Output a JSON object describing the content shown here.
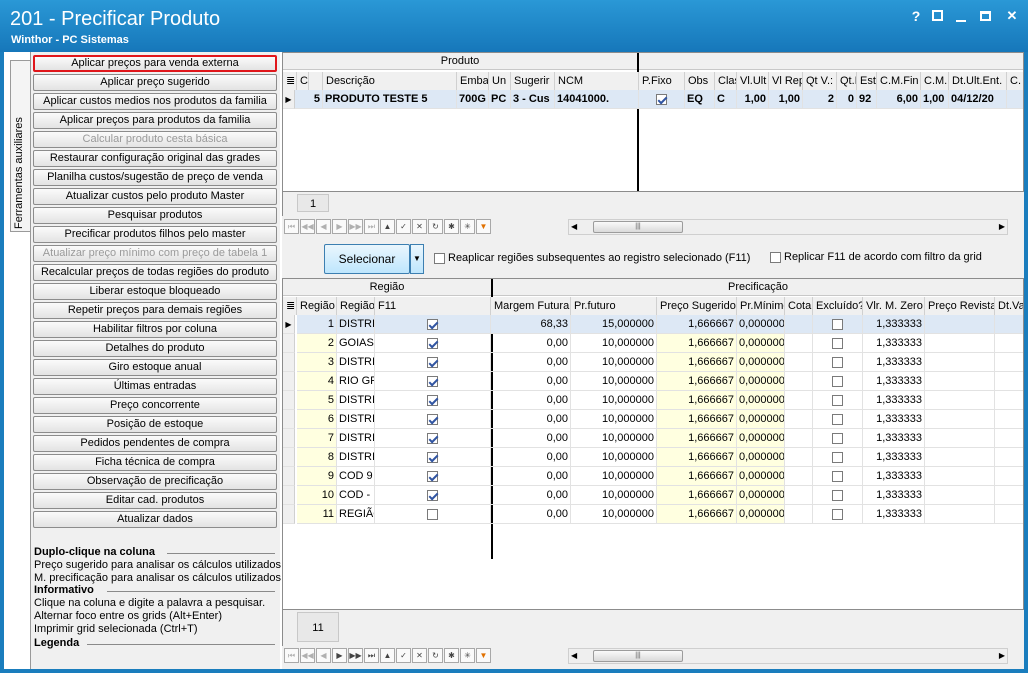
{
  "window": {
    "title": "201 - Precificar Produto",
    "subtitle": "Winthor - PC Sistemas",
    "help_glyph": "?"
  },
  "sidebar_tab": "Ferramentas auxiliares",
  "actions": [
    {
      "label": "Aplicar preços para venda externa",
      "state": "active"
    },
    {
      "label": "Aplicar preço sugerido",
      "state": "normal"
    },
    {
      "label": "Aplicar custos medios nos produtos da familia",
      "state": "normal"
    },
    {
      "label": "Aplicar preços para produtos da familia",
      "state": "normal"
    },
    {
      "label": "Calcular produto cesta básica",
      "state": "disabled"
    },
    {
      "label": "Restaurar configuração original das grades",
      "state": "normal"
    },
    {
      "label": "Planilha custos/sugestão de preço de venda",
      "state": "normal"
    },
    {
      "label": "Atualizar custos pelo produto Master",
      "state": "normal"
    },
    {
      "label": "Pesquisar produtos",
      "state": "normal"
    },
    {
      "label": "Precificar produtos filhos pelo master",
      "state": "normal"
    },
    {
      "label": "Atualizar preço mínimo com preço de tabela 1",
      "state": "disabled"
    },
    {
      "label": "Recalcular preços de todas regiões do produto",
      "state": "normal"
    },
    {
      "label": "Liberar estoque bloqueado",
      "state": "normal"
    },
    {
      "label": "Repetir preços para demais regiões",
      "state": "normal"
    },
    {
      "label": "Habilitar filtros por coluna",
      "state": "normal"
    },
    {
      "label": "Detalhes do produto",
      "state": "normal"
    },
    {
      "label": "Giro estoque anual",
      "state": "normal"
    },
    {
      "label": "Últimas entradas",
      "state": "normal"
    },
    {
      "label": "Preço concorrente",
      "state": "normal"
    },
    {
      "label": "Posição de estoque",
      "state": "normal"
    },
    {
      "label": "Pedidos pendentes de compra",
      "state": "normal"
    },
    {
      "label": "Ficha técnica de compra",
      "state": "normal"
    },
    {
      "label": "Observação de precificação",
      "state": "normal"
    },
    {
      "label": "Editar cad. produtos",
      "state": "normal"
    },
    {
      "label": "Atualizar dados",
      "state": "normal"
    }
  ],
  "help": {
    "dbl_header": "Duplo-clique na coluna",
    "dbl_line1": "Preço sugerido para analisar os cálculos utilizados.",
    "dbl_line2": "M. precificação para analisar os cálculos utilizados.",
    "info_header": "Informativo",
    "info_line1": "Clique na coluna e digite a palavra a pesquisar.",
    "info_line2": "Alternar foco entre os grids (Alt+Enter)",
    "info_line3": "Imprimir grid selecionada (Ctrl+T)",
    "legend_header": "Legenda"
  },
  "product_grid": {
    "band_title": "Produto",
    "columns": [
      "C",
      "",
      "Descrição",
      "Emba",
      "Un",
      "Sugerir",
      "NCM",
      "P.Fixo",
      "Obs",
      "Clas",
      "Vl.Ult",
      "Vl Rep",
      "Qt V.:",
      "Qt.I",
      "Est",
      "C.M.Fin",
      "C.M.",
      "Dt.Ult.Ent.",
      "C."
    ],
    "row": [
      "5",
      "PRODUTO TESTE 5",
      "700G",
      "PC",
      "3 - Cus",
      "14041000.",
      "",
      "EQ",
      "C",
      "1,00",
      "1,00",
      "2",
      "0",
      "92",
      "6,00",
      "1,00",
      "04/12/20",
      ""
    ],
    "row_pfixo_checked": true,
    "count": "1"
  },
  "toolbar": {
    "select_label": "Selecionar",
    "opt1_label": "Reaplicar regiões subsequentes ao registro selecionado (F11)",
    "opt2_label": "Replicar F11 de acordo com filtro da grid"
  },
  "region_grid": {
    "band_region": "Região",
    "band_pricing": "Precificação",
    "columns": [
      "Região",
      "Região",
      "F11",
      "Margem Futura",
      "Pr.futuro",
      "Preço Sugerido",
      "Pr.Mínimo",
      "Cota",
      "Excluído?",
      "Vlr. M. Zero",
      "Preço Revista",
      "Dt.Va"
    ],
    "rows": [
      {
        "id": "1",
        "name": "DISTRI",
        "f11": true,
        "margem": "68,33",
        "prfuturo": "15,000000",
        "sugerido": "1,666667",
        "prmin": "0,000000",
        "excluido": false,
        "zero": "1,333333"
      },
      {
        "id": "2",
        "name": "GOIAS",
        "f11": true,
        "margem": "0,00",
        "prfuturo": "10,000000",
        "sugerido": "1,666667",
        "prmin": "0,000000",
        "excluido": false,
        "zero": "1,333333"
      },
      {
        "id": "3",
        "name": "DISTRI",
        "f11": true,
        "margem": "0,00",
        "prfuturo": "10,000000",
        "sugerido": "1,666667",
        "prmin": "0,000000",
        "excluido": false,
        "zero": "1,333333"
      },
      {
        "id": "4",
        "name": "RIO GR",
        "f11": true,
        "margem": "0,00",
        "prfuturo": "10,000000",
        "sugerido": "1,666667",
        "prmin": "0,000000",
        "excluido": false,
        "zero": "1,333333"
      },
      {
        "id": "5",
        "name": "DISTRI",
        "f11": true,
        "margem": "0,00",
        "prfuturo": "10,000000",
        "sugerido": "1,666667",
        "prmin": "0,000000",
        "excluido": false,
        "zero": "1,333333"
      },
      {
        "id": "6",
        "name": "DISTRI",
        "f11": true,
        "margem": "0,00",
        "prfuturo": "10,000000",
        "sugerido": "1,666667",
        "prmin": "0,000000",
        "excluido": false,
        "zero": "1,333333"
      },
      {
        "id": "7",
        "name": "DISTRI",
        "f11": true,
        "margem": "0,00",
        "prfuturo": "10,000000",
        "sugerido": "1,666667",
        "prmin": "0,000000",
        "excluido": false,
        "zero": "1,333333"
      },
      {
        "id": "8",
        "name": "DISTRI",
        "f11": true,
        "margem": "0,00",
        "prfuturo": "10,000000",
        "sugerido": "1,666667",
        "prmin": "0,000000",
        "excluido": false,
        "zero": "1,333333"
      },
      {
        "id": "9",
        "name": "COD 9",
        "f11": true,
        "margem": "0,00",
        "prfuturo": "10,000000",
        "sugerido": "1,666667",
        "prmin": "0,000000",
        "excluido": false,
        "zero": "1,333333"
      },
      {
        "id": "10",
        "name": "COD - :",
        "f11": true,
        "margem": "0,00",
        "prfuturo": "10,000000",
        "sugerido": "1,666667",
        "prmin": "0,000000",
        "excluido": false,
        "zero": "1,333333"
      },
      {
        "id": "11",
        "name": "REGIÃO",
        "f11": false,
        "margem": "0,00",
        "prfuturo": "10,000000",
        "sugerido": "1,666667",
        "prmin": "0,000000",
        "excluido": false,
        "zero": "1,333333"
      }
    ],
    "count": "11"
  },
  "colors": {
    "titlebar": "#1a7dbd",
    "highlight_border": "#e0161b",
    "yellow_cell": "#ffffe0"
  }
}
